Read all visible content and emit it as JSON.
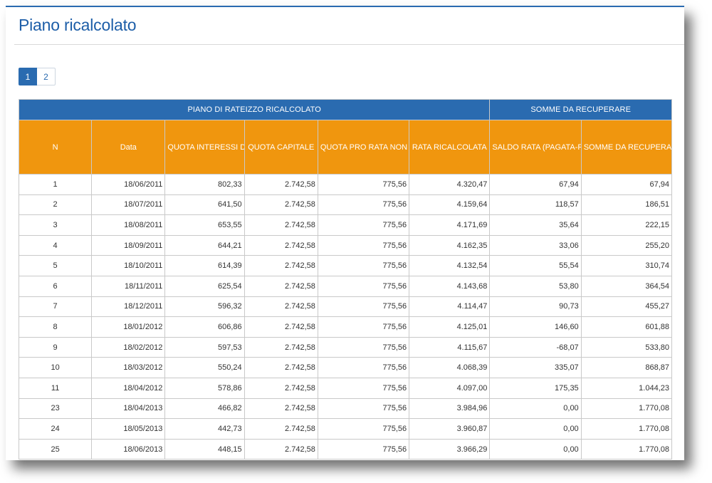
{
  "page": {
    "title": "Piano ricalcolato"
  },
  "pagination": {
    "pages": [
      "1",
      "2"
    ],
    "active": "1"
  },
  "table": {
    "group_headers": [
      "PIANO DI RATEIZZO RICALCOLATO",
      "SOMME DA RECUPERARE"
    ],
    "columns": [
      "N",
      "Data",
      "QUOTA INTERESSI DI DILAZIONE",
      "QUOTA CAPITALE",
      "QUOTA PRO RATA NON IN AMMORTAMENTO",
      "RATA RICALCOLATA",
      "SALDO RATA (PAGATA-RICALCOLATA)",
      "SOMME DA RECUPERARE"
    ],
    "rows": [
      [
        "1",
        "18/06/2011",
        "802,33",
        "2.742,58",
        "775,56",
        "4.320,47",
        "67,94",
        "67,94"
      ],
      [
        "2",
        "18/07/2011",
        "641,50",
        "2.742,58",
        "775,56",
        "4.159,64",
        "118,57",
        "186,51"
      ],
      [
        "3",
        "18/08/2011",
        "653,55",
        "2.742,58",
        "775,56",
        "4.171,69",
        "35,64",
        "222,15"
      ],
      [
        "4",
        "18/09/2011",
        "644,21",
        "2.742,58",
        "775,56",
        "4.162,35",
        "33,06",
        "255,20"
      ],
      [
        "5",
        "18/10/2011",
        "614,39",
        "2.742,58",
        "775,56",
        "4.132,54",
        "55,54",
        "310,74"
      ],
      [
        "6",
        "18/11/2011",
        "625,54",
        "2.742,58",
        "775,56",
        "4.143,68",
        "53,80",
        "364,54"
      ],
      [
        "7",
        "18/12/2011",
        "596,32",
        "2.742,58",
        "775,56",
        "4.114,47",
        "90,73",
        "455,27"
      ],
      [
        "8",
        "18/01/2012",
        "606,86",
        "2.742,58",
        "775,56",
        "4.125,01",
        "146,60",
        "601,88"
      ],
      [
        "9",
        "18/02/2012",
        "597,53",
        "2.742,58",
        "775,56",
        "4.115,67",
        "-68,07",
        "533,80"
      ],
      [
        "10",
        "18/03/2012",
        "550,24",
        "2.742,58",
        "775,56",
        "4.068,39",
        "335,07",
        "868,87"
      ],
      [
        "11",
        "18/04/2012",
        "578,86",
        "2.742,58",
        "775,56",
        "4.097,00",
        "175,35",
        "1.044,23"
      ],
      [
        "23",
        "18/04/2013",
        "466,82",
        "2.742,58",
        "775,56",
        "3.984,96",
        "0,00",
        "1.770,08"
      ],
      [
        "24",
        "18/05/2013",
        "442,73",
        "2.742,58",
        "775,56",
        "3.960,87",
        "0,00",
        "1.770,08"
      ],
      [
        "25",
        "18/06/2013",
        "448,15",
        "2.742,58",
        "775,56",
        "3.966,29",
        "0,00",
        "1.770,08"
      ]
    ]
  },
  "colors": {
    "accent_blue": "#2a6bb0",
    "header_orange": "#f0960e"
  }
}
